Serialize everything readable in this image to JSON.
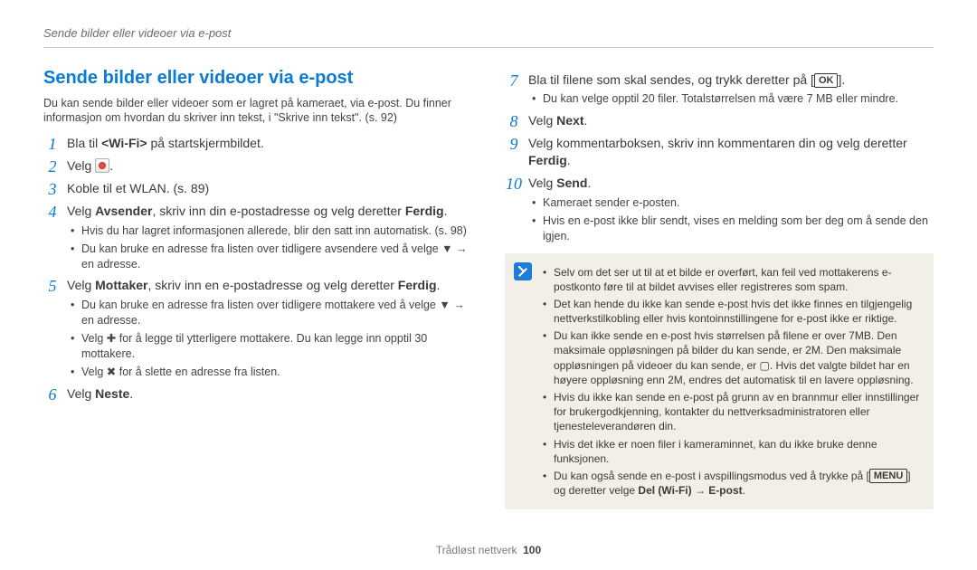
{
  "running_head": "Sende bilder eller videoer via e-post",
  "section_title": "Sende bilder eller videoer via e-post",
  "intro": "Du kan sende bilder eller videoer som er lagret på kameraet, via e-post. Du finner informasjon om hvordan du skriver inn tekst, i \"Skrive inn tekst\". (s. 92)",
  "steps_left": {
    "s1": {
      "num": "1",
      "pre": "Bla til ",
      "key": "<Wi-Fi>",
      "post": " på startskjermbildet."
    },
    "s2": {
      "num": "2",
      "pre": "Velg ",
      "post": "."
    },
    "s3": {
      "num": "3",
      "text": "Koble til et WLAN. (s. 89)"
    },
    "s4": {
      "num": "4",
      "pre": "Velg ",
      "b1": "Avsender",
      "mid": ", skriv inn din e-postadresse og velg deretter ",
      "b2": "Ferdig",
      "post": ".",
      "sub": [
        "Hvis du har lagret informasjonen allerede, blir den satt inn automatisk. (s. 98)",
        "Du kan bruke en adresse fra listen over tidligere avsendere ved å velge ▼ → en adresse."
      ]
    },
    "s5": {
      "num": "5",
      "pre": "Velg ",
      "b1": "Mottaker",
      "mid": ", skriv inn en e-postadresse og velg deretter ",
      "b2": "Ferdig",
      "post": ".",
      "sub": [
        "Du kan bruke en adresse fra listen over tidligere mottakere ved å velge ▼ → en adresse.",
        "Velg ✚ for å legge til ytterligere mottakere. Du kan legge inn opptil 30 mottakere.",
        "Velg ✖ for å slette en adresse fra listen."
      ]
    },
    "s6": {
      "num": "6",
      "pre": "Velg ",
      "b1": "Neste",
      "post": "."
    }
  },
  "steps_right": {
    "s7": {
      "num": "7",
      "pre": "Bla til filene som skal sendes, og trykk deretter på [",
      "key": "OK",
      "post": "].",
      "sub": [
        "Du kan velge opptil 20 filer. Totalstørrelsen må være 7 MB eller mindre."
      ]
    },
    "s8": {
      "num": "8",
      "pre": "Velg ",
      "b1": "Next",
      "post": "."
    },
    "s9": {
      "num": "9",
      "pre": "Velg kommentarboksen, skriv inn kommentaren din og velg deretter ",
      "b1": "Ferdig",
      "post": "."
    },
    "s10": {
      "num": "10",
      "pre": "Velg ",
      "b1": "Send",
      "post": ".",
      "sub": [
        "Kameraet sender e-posten.",
        "Hvis en e-post ikke blir sendt, vises en melding som ber deg om å sende den igjen."
      ]
    }
  },
  "note_items": [
    "Selv om det ser ut til at et bilde er overført, kan feil ved mottakerens e-postkonto føre til at bildet avvises eller registreres som spam.",
    "Det kan hende du ikke kan sende e-post hvis det ikke finnes en tilgjengelig nettverkstilkobling eller hvis kontoinnstillingene for e-post ikke er riktige.",
    "Du kan ikke sende en e-post hvis størrelsen på filene er over 7MB. Den maksimale oppløsningen på bilder du kan sende, er 2M. Den maksimale oppløsningen på videoer du kan sende, er ▢. Hvis det valgte bildet har en høyere oppløsning enn 2M, endres det automatisk til en lavere oppløsning.",
    "Hvis du ikke kan sende en e-post på grunn av en brannmur eller innstillinger for brukergodkjenning, kontakter du nettverksadministratoren eller tjenesteleverandøren din.",
    "Hvis det ikke er noen filer i kameraminnet, kan du ikke bruke denne funksjonen."
  ],
  "note_last": {
    "pre": "Du kan også sende en e-post i avspillingsmodus ved å trykke på [",
    "key": "MENU",
    "mid": "] og deretter velge ",
    "b1": "Del (Wi-Fi)",
    "arrow": " → ",
    "b2": "E-post",
    "post": "."
  },
  "footer": {
    "section": "Trådløst nettverk",
    "page": "100"
  }
}
